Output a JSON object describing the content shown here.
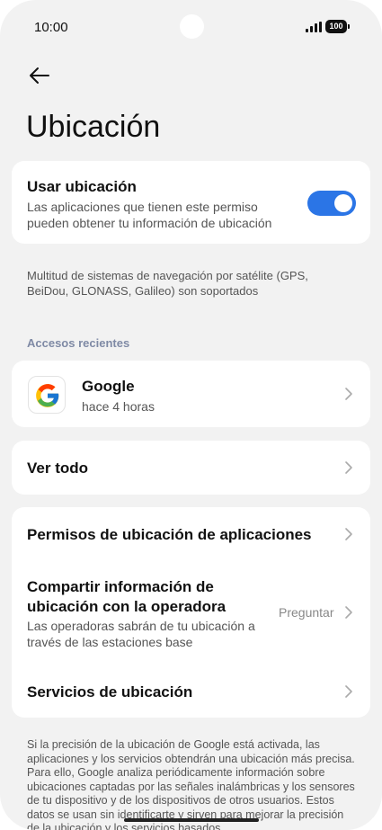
{
  "status": {
    "time": "10:00",
    "battery": "100"
  },
  "page": {
    "title": "Ubicación"
  },
  "location_toggle": {
    "title": "Usar ubicación",
    "description": "Las aplicaciones que tienen este permiso pueden obtener tu información de ubicación",
    "enabled": true
  },
  "gnss_note": "Multitud de sistemas de navegación por satélite (GPS, BeiDou, GLONASS, Galileo) son soportados",
  "recent": {
    "section_label": "Accesos recientes",
    "apps": [
      {
        "name": "Google",
        "time": "hace 4 horas",
        "icon": "google-icon"
      }
    ],
    "see_all": "Ver todo"
  },
  "settings": {
    "app_permissions": "Permisos de ubicación de aplicaciones",
    "carrier_share": {
      "title": "Compartir información de ubicación con la operadora",
      "description": "Las operadoras sabrán de tu ubicación a través de las estaciones base",
      "value": "Preguntar"
    },
    "location_services": "Servicios de ubicación"
  },
  "footer_text": "Si la precisión de la ubicación de Google está activada, las aplicaciones y los servicios obtendrán una ubicación más precisa. Para ello, Google analiza periódicamente información sobre ubicaciones captadas por las señales inalámbricas y los sensores de tu dispositivo y de los dispositivos de otros usuarios. Estos datos se usan sin identificarte y sirven para mejorar la precisión de la ubicación y los servicios basados",
  "colors": {
    "accent": "#2b75e6",
    "background": "#f2f2f2",
    "section_label": "#7f8aa5"
  }
}
